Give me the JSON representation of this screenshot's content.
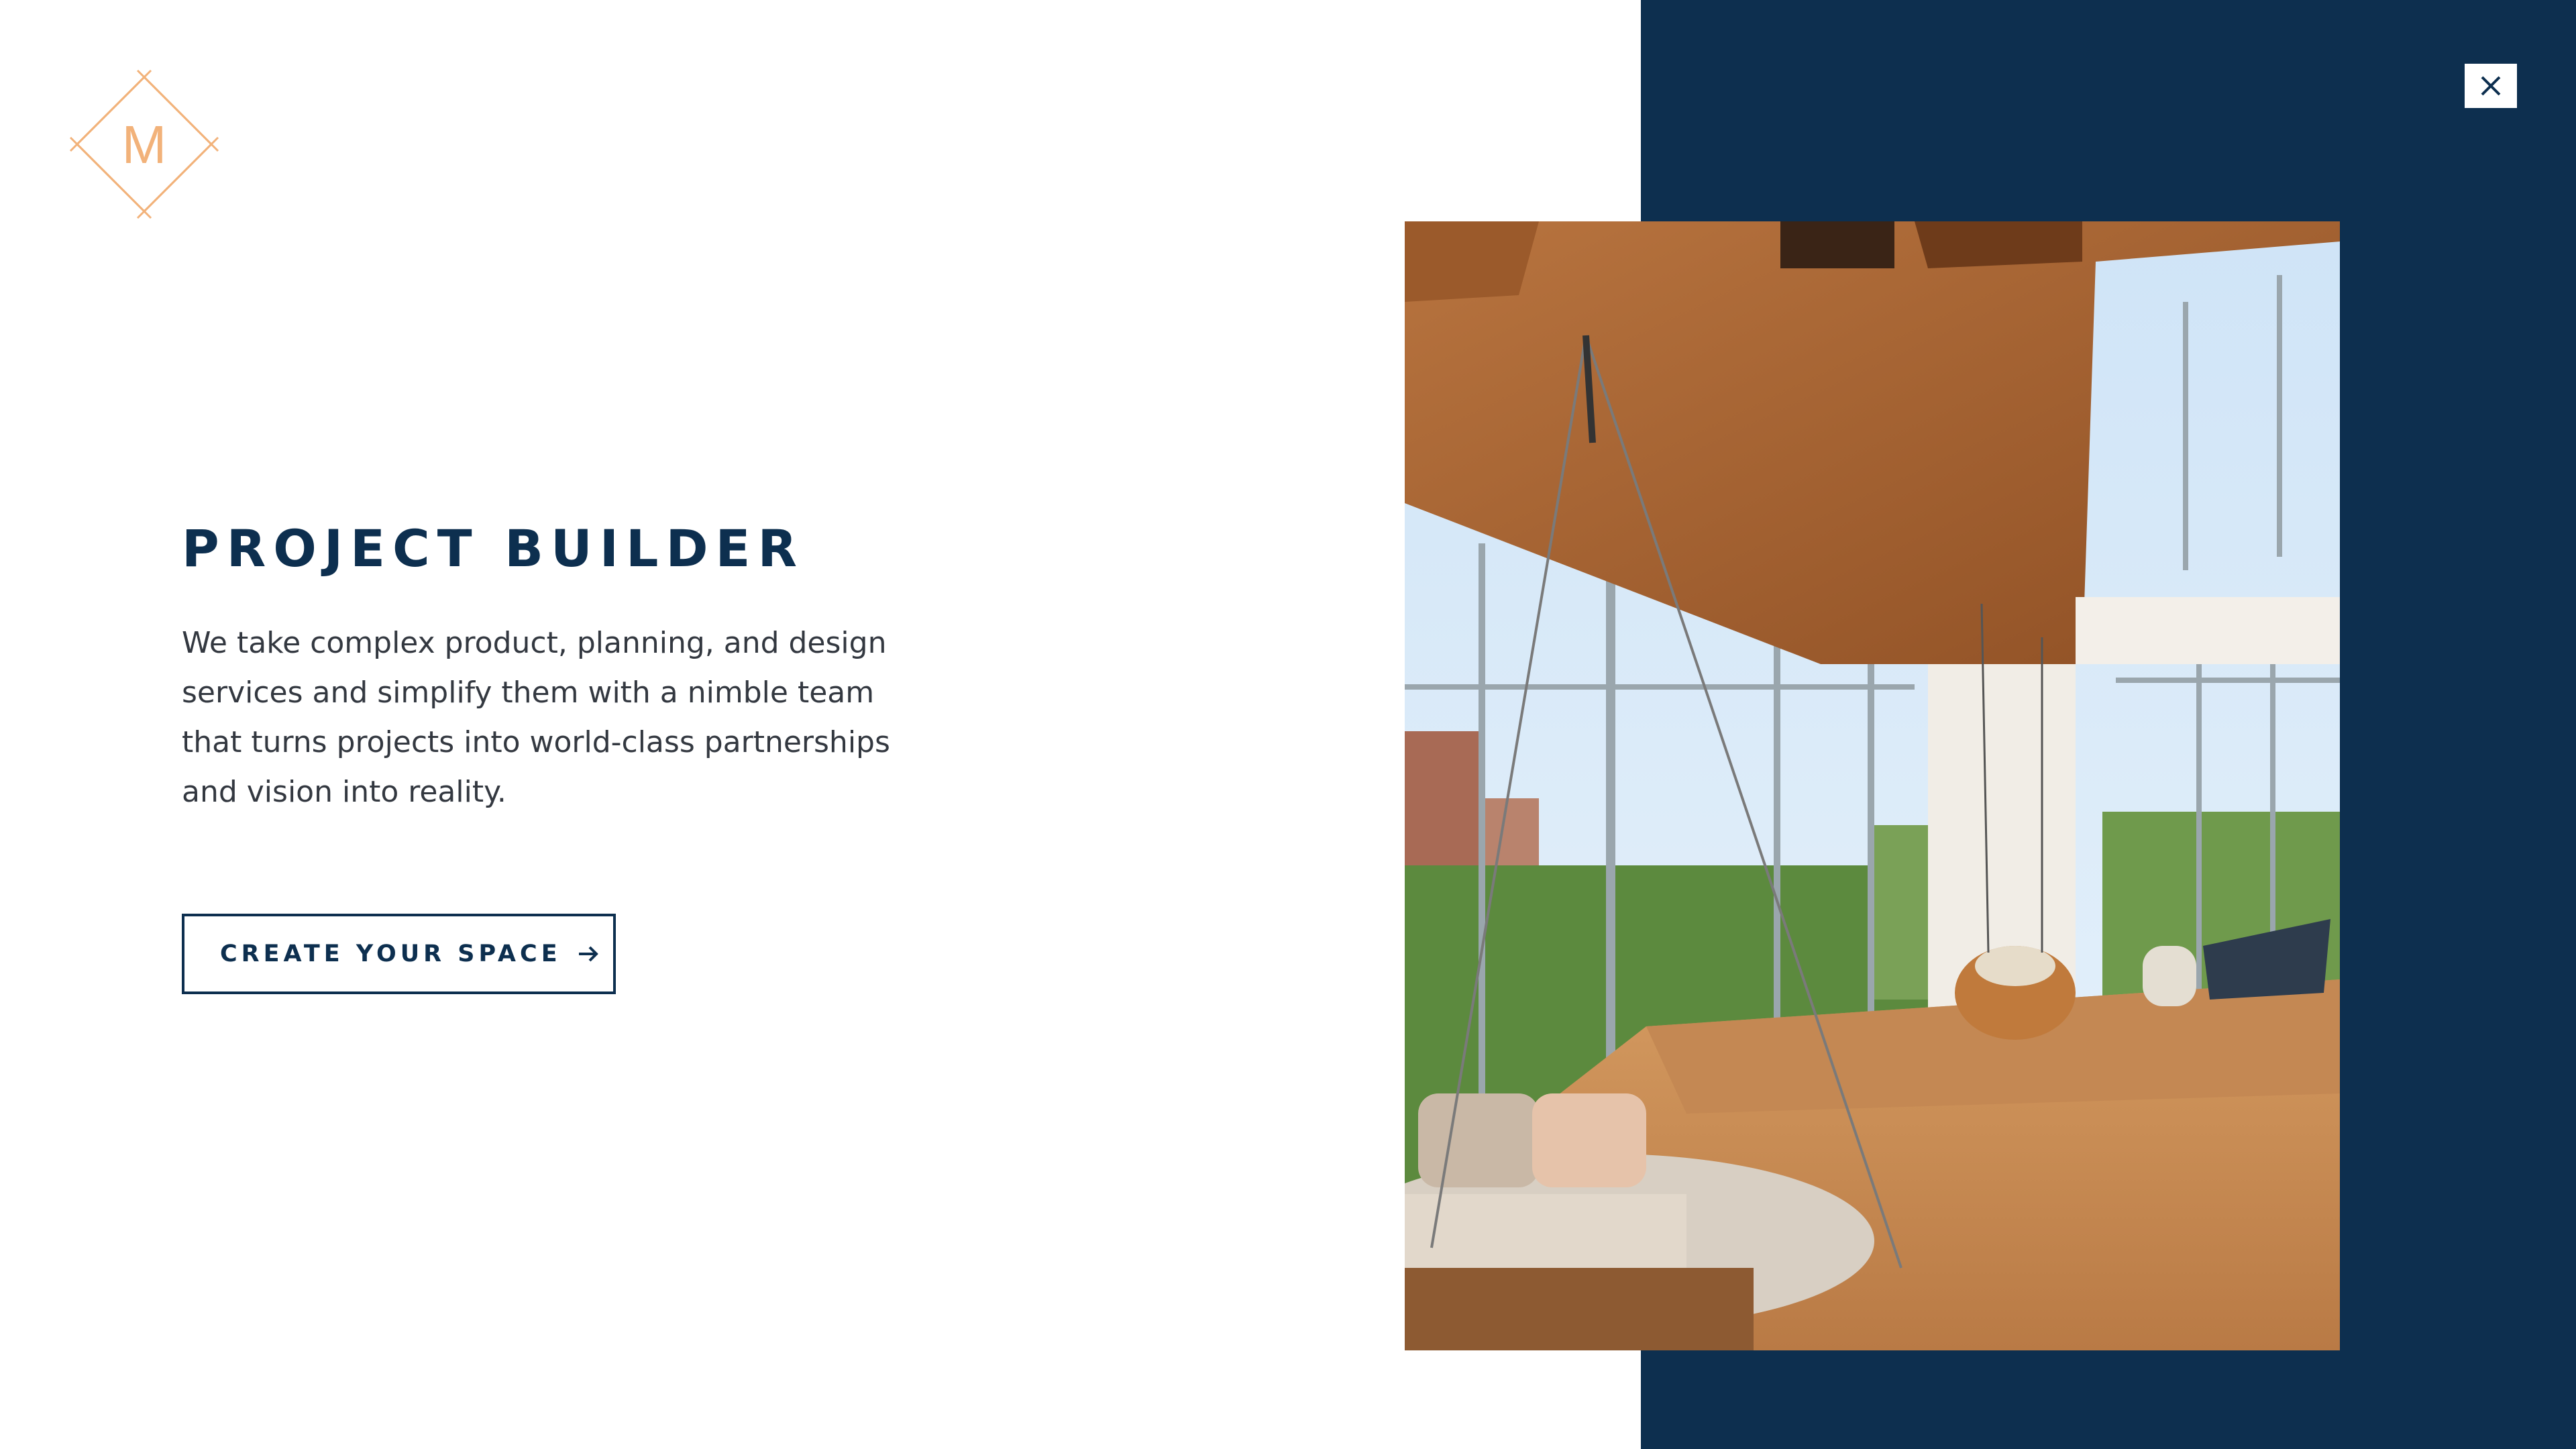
{
  "logo": {
    "letter": "M"
  },
  "close": {
    "label": "Close",
    "icon": "close-icon"
  },
  "hero": {
    "title": "PROJECT BUILDER",
    "description_lines": [
      "We take complex product, planning, and design",
      "services and simplify them with a nimble team",
      "that turns projects into world-class partnerships",
      "and vision into reality."
    ],
    "cta_label": "CREATE YOUR SPACE",
    "cta_icon": "arrow-right-icon"
  },
  "colors": {
    "navy": "#0d2f4f",
    "gold": "#f2b27a",
    "text": "#333840",
    "background": "#ffffff"
  }
}
